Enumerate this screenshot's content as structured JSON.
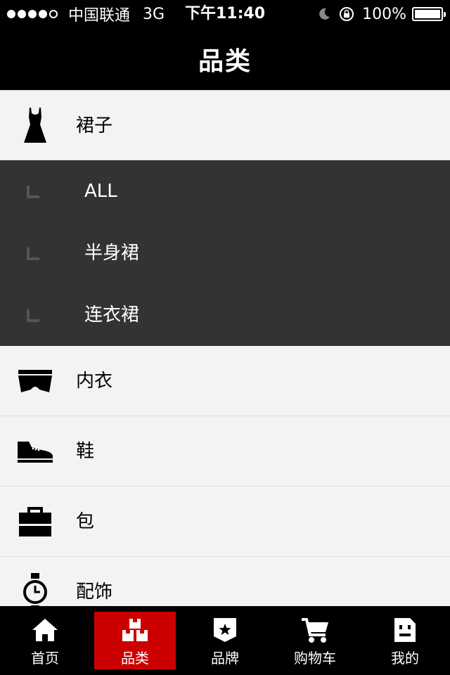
{
  "status_bar": {
    "carrier": "中国联通",
    "network": "3G",
    "time": "下午11:40",
    "battery": "100%"
  },
  "navbar": {
    "title": "品类"
  },
  "categories": [
    {
      "label": "裙子",
      "icon": "dress-icon"
    },
    {
      "label": "内衣",
      "icon": "underwear-icon"
    },
    {
      "label": "鞋",
      "icon": "shoe-icon"
    },
    {
      "label": "包",
      "icon": "bag-icon"
    },
    {
      "label": "配饰",
      "icon": "watch-icon"
    }
  ],
  "subcategories": [
    {
      "label": "ALL"
    },
    {
      "label": "半身裙"
    },
    {
      "label": "连衣裙"
    }
  ],
  "tabs": [
    {
      "label": "首页",
      "icon": "home-icon"
    },
    {
      "label": "品类",
      "icon": "category-icon",
      "active": true
    },
    {
      "label": "品牌",
      "icon": "brand-icon"
    },
    {
      "label": "购物车",
      "icon": "cart-icon"
    },
    {
      "label": "我的",
      "icon": "profile-icon"
    }
  ],
  "colors": {
    "accent": "#cc0000",
    "bar_background": "#000000",
    "list_background": "#f3f3f3",
    "sub_panel_background": "#333333"
  }
}
